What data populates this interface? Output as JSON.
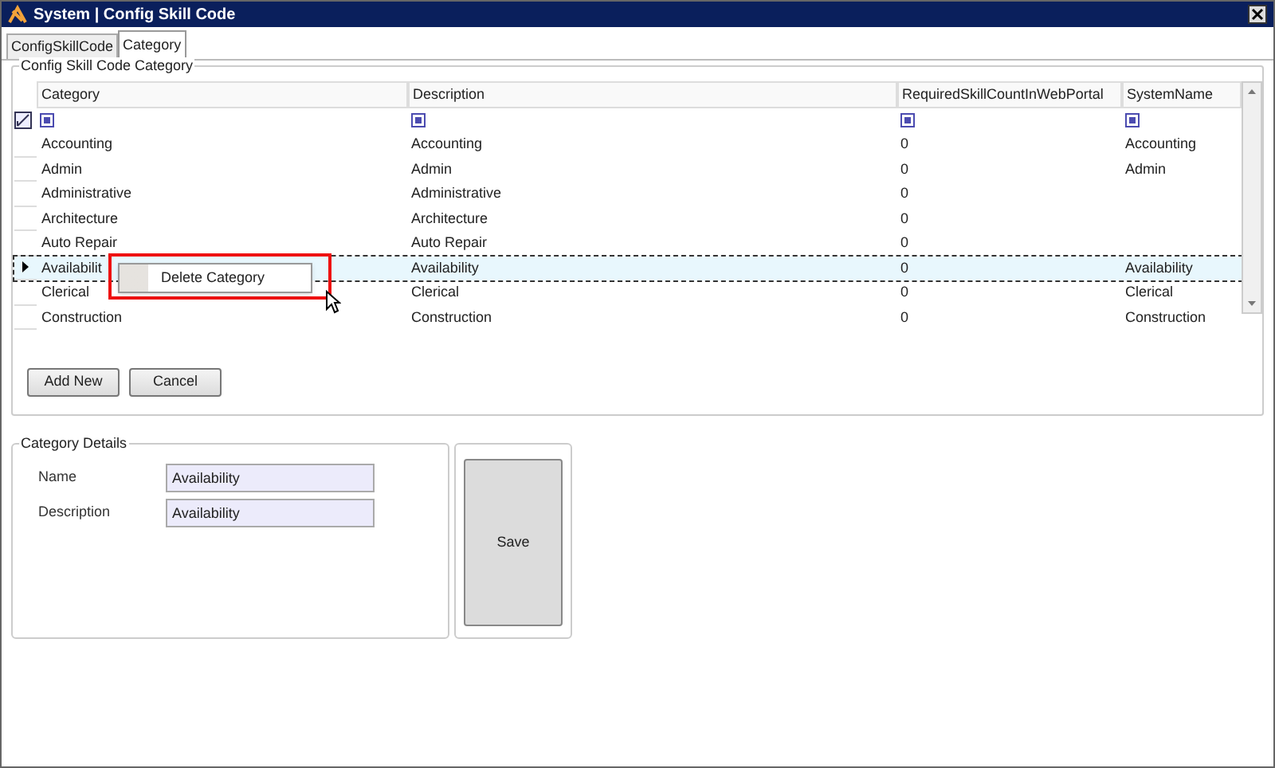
{
  "window": {
    "title": "System | Config Skill Code"
  },
  "tabs": [
    {
      "label": "ConfigSkillCode",
      "selected": false
    },
    {
      "label": "Category",
      "selected": true
    }
  ],
  "grid_group": {
    "title": "Config Skill Code Category"
  },
  "table": {
    "columns": [
      "Category",
      "Description",
      "RequiredSkillCountInWebPortal",
      "SystemName"
    ],
    "rows": [
      {
        "category": "Accounting",
        "description": "Accounting",
        "required": "0",
        "system_name": "Accounting",
        "selected": false
      },
      {
        "category": "Admin",
        "description": "Admin",
        "required": "0",
        "system_name": "Admin",
        "selected": false
      },
      {
        "category": "Administrative",
        "description": "Administrative",
        "required": "0",
        "selected": false
      },
      {
        "category": "Architecture",
        "description": "Architecture",
        "required": "0",
        "selected": false
      },
      {
        "category": "Auto Repair",
        "description": "Auto Repair",
        "required": "0",
        "selected": false
      },
      {
        "category": "Availabilit",
        "description": "Availability",
        "required": "0",
        "system_name": "Availability",
        "selected": true
      },
      {
        "category": "Clerical",
        "description": "Clerical",
        "required": "0",
        "system_name": "Clerical",
        "selected": false
      },
      {
        "category": "Construction",
        "description": "Construction",
        "required": "0",
        "system_name": "Construction",
        "selected": false
      }
    ]
  },
  "context_menu": {
    "items": [
      "Delete  Category"
    ]
  },
  "buttons": [
    "Add New",
    "Cancel"
  ],
  "details": {
    "title": "Category Details",
    "fields": [
      {
        "label": "Name",
        "value": "Availability"
      },
      {
        "label": "Description",
        "value": "Availability"
      }
    ]
  },
  "save_button": "Save"
}
